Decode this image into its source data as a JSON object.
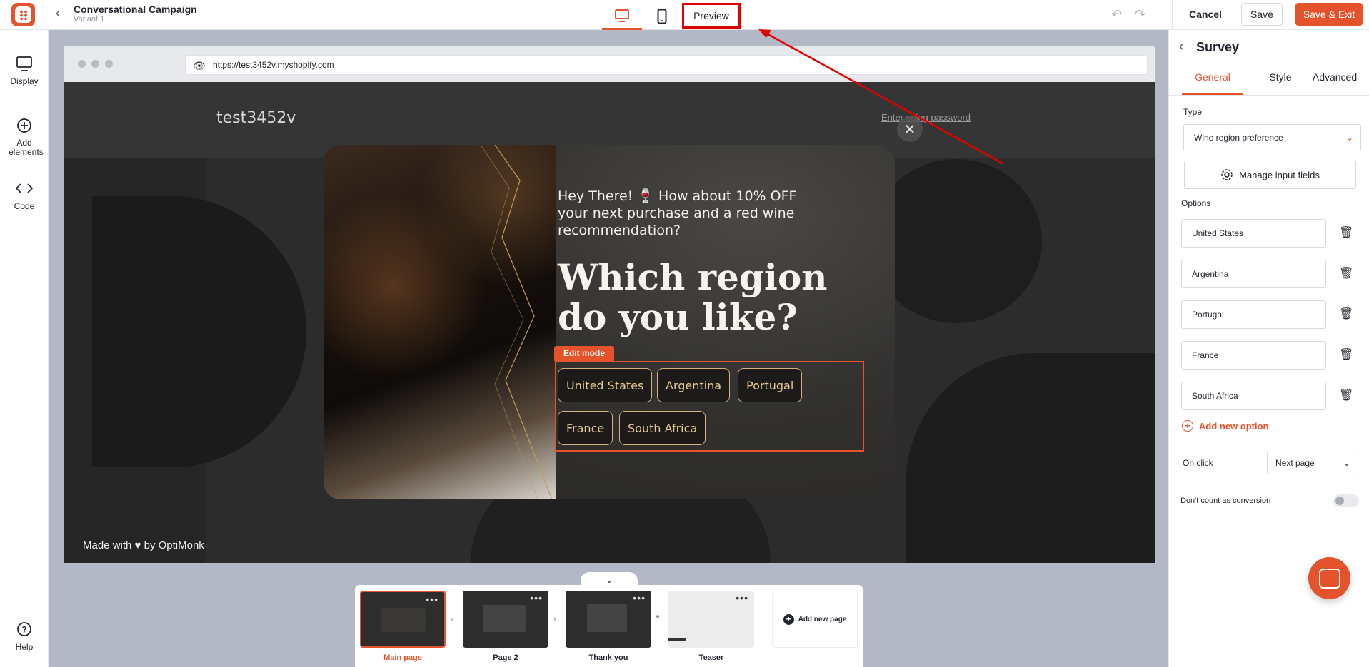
{
  "header": {
    "campaign_title": "Conversational Campaign",
    "variant": "Variant 1",
    "preview_label": "Preview",
    "cancel_label": "Cancel",
    "save_label": "Save",
    "save_exit_label": "Save & Exit"
  },
  "left_sidebar": {
    "items": [
      {
        "label": "Display",
        "icon": "monitor-icon"
      },
      {
        "label": "Add elements",
        "icon": "plus-circle-icon"
      },
      {
        "label": "Code",
        "icon": "code-icon"
      }
    ],
    "help_label": "Help"
  },
  "browser": {
    "url": "https://test3452v.myshopify.com"
  },
  "site": {
    "store_name": "test3452v",
    "password_link": "Enter using password",
    "made_with": "Made with ♥ by OptiMonk"
  },
  "popup": {
    "intro": "Hey There! 🍷 How about 10% OFF your next purchase and a red wine recommendation?",
    "headline": "Which region do you like?",
    "edit_mode_label": "Edit mode",
    "options": [
      "United States",
      "Argentina",
      "Portugal",
      "France",
      "South Africa"
    ]
  },
  "right_panel": {
    "title": "Survey",
    "tabs": [
      "General",
      "Style",
      "Advanced"
    ],
    "type_label": "Type",
    "type_value": "Wine region preference",
    "manage_label": "Manage input fields",
    "options_label": "Options",
    "options": [
      "United States",
      "Argentina",
      "Portugal",
      "France",
      "South Africa"
    ],
    "add_option_label": "Add new option",
    "on_click_label": "On click",
    "on_click_value": "Next page",
    "conversion_label": "Don't count as conversion",
    "conversion_enabled": false
  },
  "pages": {
    "items": [
      {
        "label": "Main page",
        "active": true
      },
      {
        "label": "Page 2",
        "active": false
      },
      {
        "label": "Thank you",
        "active": false
      },
      {
        "label": "Teaser",
        "active": false
      }
    ],
    "add_page_label": "Add new page"
  },
  "colors": {
    "accent": "#e4532c",
    "annotation": "#e00000",
    "popup_bg": "#262524",
    "option_border": "#d4b27c"
  }
}
